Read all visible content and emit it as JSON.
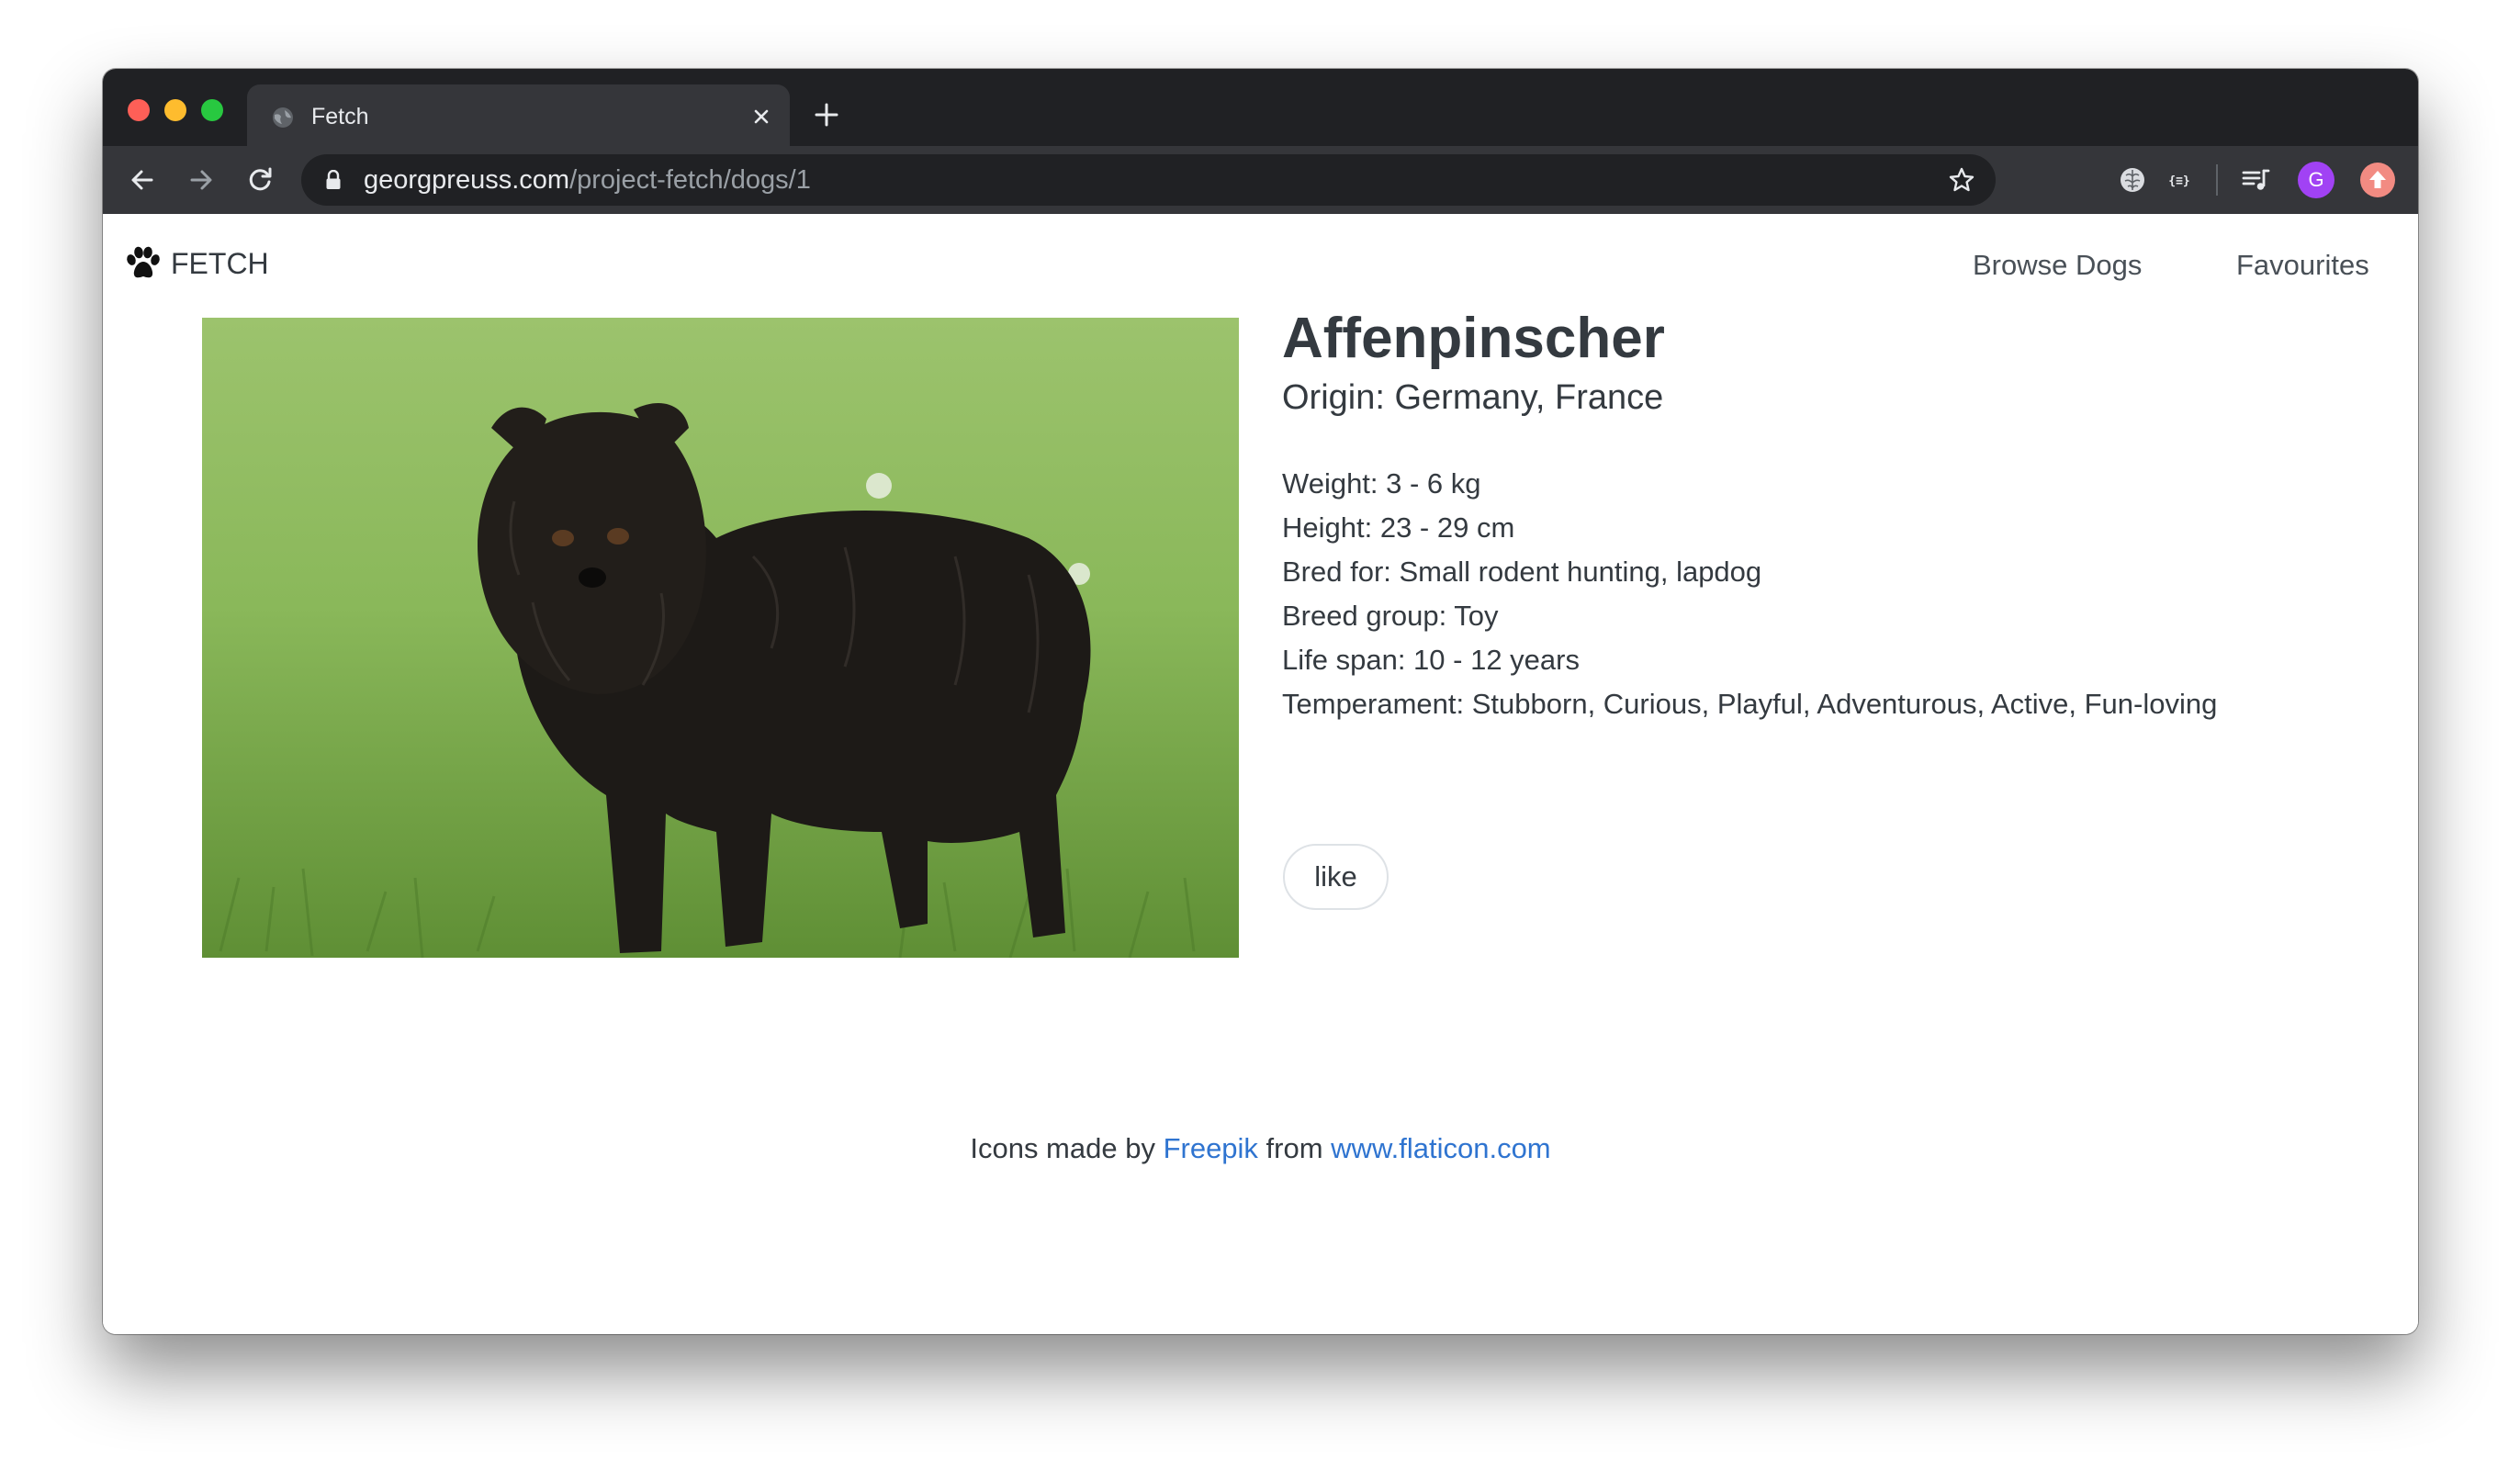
{
  "browser": {
    "tab_title": "Fetch",
    "url_host": "georgpreuss.com",
    "url_path": "/project-fetch/dogs/1",
    "profile_initial": "G"
  },
  "site": {
    "brand": "FETCH",
    "nav": {
      "browse": "Browse Dogs",
      "favourites": "Favourites"
    }
  },
  "dog": {
    "name": "Affenpinscher",
    "origin": "Origin: Germany, France",
    "facts": [
      "Weight: 3 - 6 kg",
      "Height: 23 - 29 cm",
      "Bred for: Small rodent hunting, lapdog",
      "Breed group: Toy",
      "Life span: 10 - 12 years",
      "Temperament: Stubborn, Curious, Playful, Adventurous, Active, Fun-loving"
    ],
    "like_label": "like"
  },
  "footer": {
    "prefix": "Icons made by ",
    "author": "Freepik",
    "middle": " from ",
    "site": "www.flaticon.com"
  },
  "colors": {
    "link": "#2f74d0",
    "text": "#343a40",
    "browser_dark": "#202124",
    "browser_toolbar": "#35363a"
  }
}
